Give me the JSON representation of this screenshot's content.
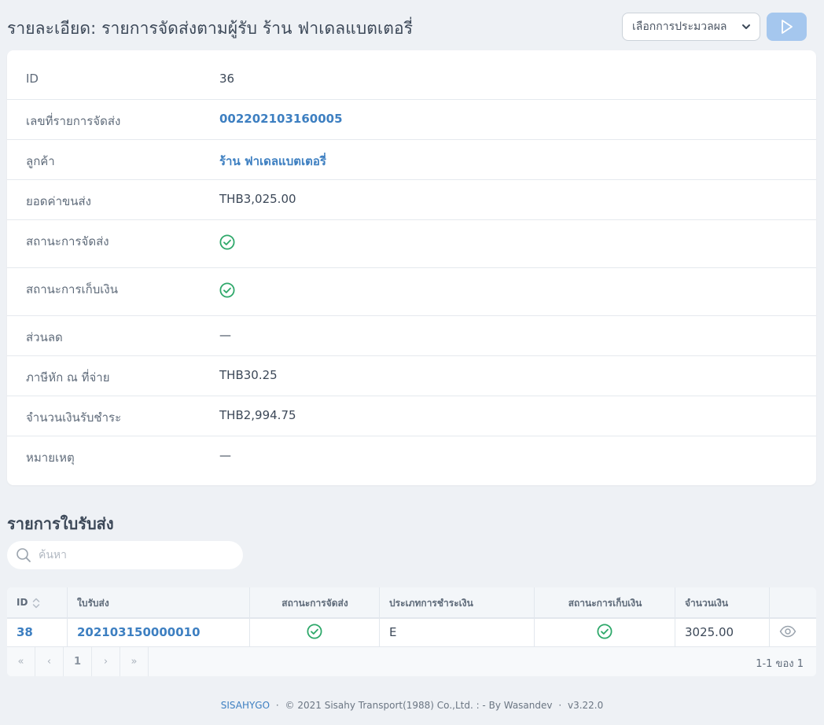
{
  "header": {
    "title": "รายละเอียด: รายการจัดส่งตามผู้รับ ร้าน ฟาเดลแบตเตอรี่",
    "action_select": "เลือกการประมวลผล"
  },
  "detail": {
    "rows": [
      {
        "label": "ID",
        "value": "36"
      },
      {
        "label": "เลขที่รายการจัดส่ง",
        "value": "002202103160005"
      },
      {
        "label": "ลูกค้า",
        "value": "ร้าน ฟาเดลแบตเตอรี่"
      },
      {
        "label": "ยอดค่าขนส่ง",
        "value": "THB3,025.00"
      },
      {
        "label": "สถานะการจัดส่ง",
        "value": "check-circle-icon"
      },
      {
        "label": "สถานะการเก็บเงิน",
        "value": "check-circle-icon"
      },
      {
        "label": "ส่วนลด",
        "value": "—"
      },
      {
        "label": "ภาษีหัก ณ ที่จ่าย",
        "value": "THB30.25"
      },
      {
        "label": "จำนวนเงินรับชำระ",
        "value": "THB2,994.75"
      },
      {
        "label": "หมายเหตุ",
        "value": "—"
      }
    ]
  },
  "section": {
    "title": "รายการใบรับส่ง",
    "search_placeholder": "ค้นหา"
  },
  "table": {
    "columns": [
      "ID",
      "ใบรับส่ง",
      "สถานะการจัดส่ง",
      "ประเภทการชำระเงิน",
      "สถานะการเก็บเงิน",
      "จำนวนเงิน"
    ],
    "rows": [
      {
        "id": "38",
        "receipt": "202103150000010",
        "delivery_status": "check-circle-icon",
        "payment_type": "E",
        "collection_status": "check-circle-icon",
        "amount": "3025.00"
      }
    ]
  },
  "pagination": {
    "first": "«",
    "prev": "‹",
    "current": "1",
    "next": "›",
    "last": "»",
    "info": "1-1 ของ 1"
  },
  "footer": {
    "brand": "SISAHYGO",
    "sep1": "·",
    "copyright": "© 2021 Sisahy Transport(1988) Co.,Ltd. : - By Wasandev",
    "sep2": "·",
    "version": "v3.22.0"
  },
  "colors": {
    "accent": "#3d7fc1",
    "success": "#2ea86a",
    "button_disabled": "#a5c7ee",
    "background": "#eef1f5"
  }
}
